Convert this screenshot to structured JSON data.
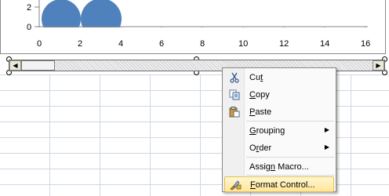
{
  "chart": {
    "y_ticks": [
      "2",
      "0"
    ],
    "x_ticks": [
      "0",
      "2",
      "4",
      "6",
      "8",
      "10",
      "12",
      "14",
      "16"
    ],
    "bubble_color": "#4f81bd"
  },
  "scrollbar": {
    "left_arrow": "◀",
    "right_arrow": "▶"
  },
  "context_menu": {
    "items": [
      {
        "pre": "Cu",
        "u": "t",
        "post": "",
        "icon": "scissors-icon"
      },
      {
        "pre": "",
        "u": "C",
        "post": "opy",
        "icon": "copy-icon"
      },
      {
        "pre": "",
        "u": "P",
        "post": "aste",
        "icon": "paste-icon"
      },
      {
        "pre": "",
        "u": "G",
        "post": "rouping",
        "submenu": "▶"
      },
      {
        "pre": "O",
        "u": "r",
        "post": "der",
        "submenu": "▶"
      },
      {
        "pre": "Assig",
        "u": "n",
        "post": " Macro..."
      },
      {
        "pre": "",
        "u": "F",
        "post": "ormat Control...",
        "icon": "format-control-icon"
      }
    ]
  }
}
